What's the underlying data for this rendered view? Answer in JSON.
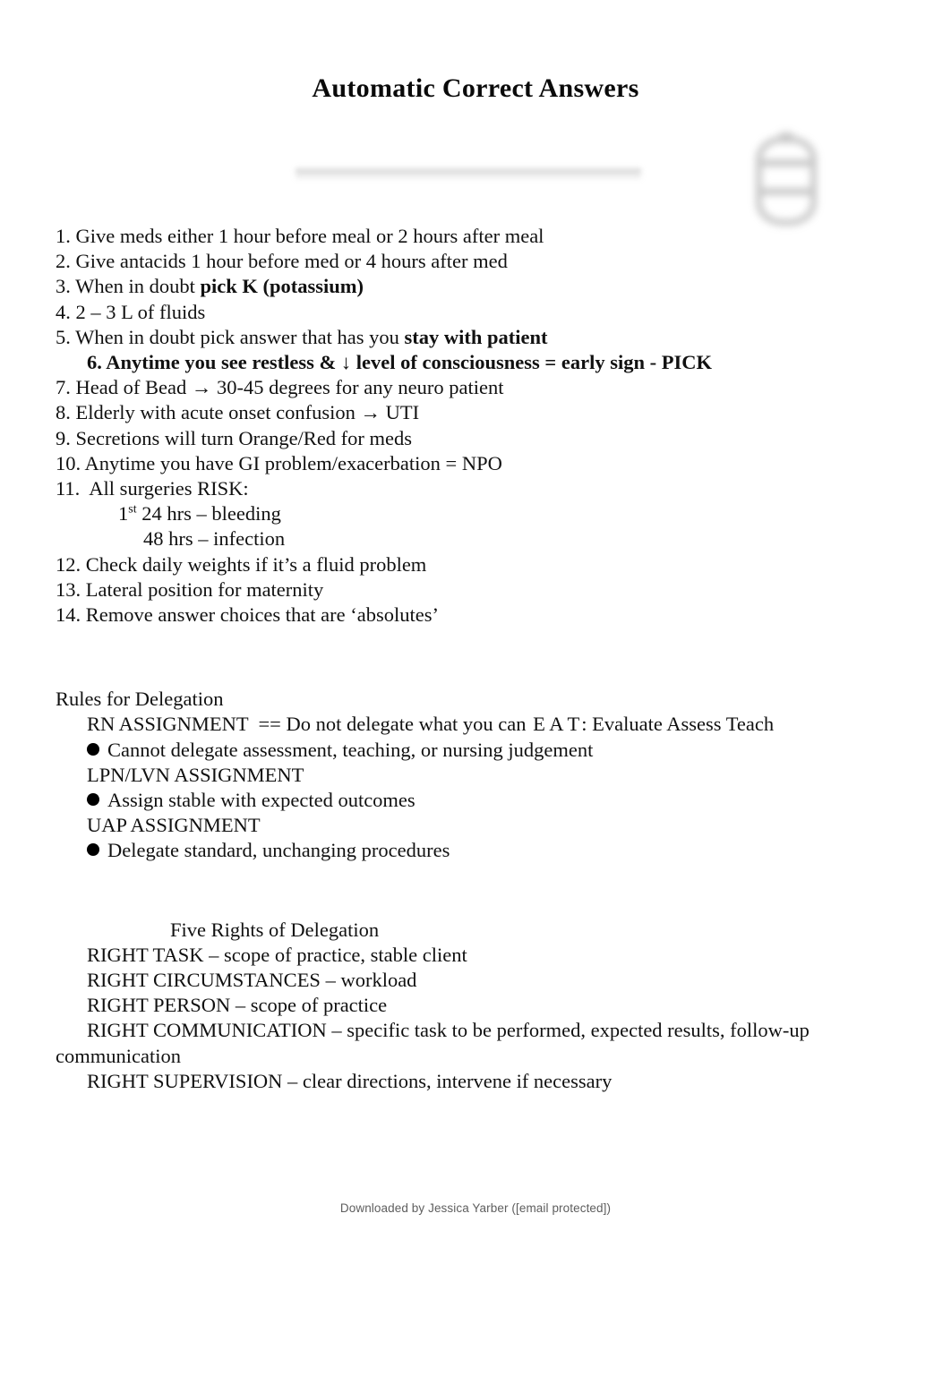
{
  "document": {
    "title": "Automatic Correct  Answers",
    "watermark_icon": "blurred-logo-watermark"
  },
  "rules_list": {
    "items": [
      {
        "num": "1.",
        "text": "Give meds either 1 hour before meal or 2 hours after meal"
      },
      {
        "num": "2.",
        "text": "Give antacids 1 hour before med or 4 hours after med"
      },
      {
        "num": "3.",
        "text": "When in doubt ",
        "bold_tail": "pick K (potassium)"
      },
      {
        "num": "4.",
        "text": "2 – 3 L of fluids"
      },
      {
        "num": "5.",
        "text": "When in doubt pick answer that has you ",
        "bold_tail": "stay with patient"
      },
      {
        "num": "6.",
        "text": "Anytime you see restless & ↓ level of consciousness = early sign - PICK"
      },
      {
        "num": "7.",
        "text": "Head of Bead → 30-45 degrees for any neuro patient"
      },
      {
        "num": "8.",
        "text": "Elderly with acute onset confusion → UTI"
      },
      {
        "num": "9.",
        "text": "Secretions will turn Orange/Red for meds"
      },
      {
        "num": "10.",
        "text": "Anytime you have GI problem/exacerbation = NPO"
      },
      {
        "num": "11.",
        "text": " All surgeries RISK:"
      }
    ],
    "surgery_risk": {
      "line1_pre": "1",
      "line1_sup": "st",
      "line1_post": " 24 hrs – bleeding",
      "line2": "48 hrs – infection"
    },
    "items_tail": [
      {
        "num": "12.",
        "text": "Check daily weights if it’s a fluid problem"
      },
      {
        "num": "13.",
        "text": "Lateral position for maternity"
      },
      {
        "num": "14.",
        "text": "Remove answer choices that are ‘absolutes’"
      }
    ]
  },
  "delegation": {
    "heading": "Rules for Delegation",
    "rn": {
      "label": "RN ASSIGNMENT  == Do not delegate what you can ",
      "highlight": "E A T",
      "highlight_color": "#1ee3f0",
      "tail": ": Evaluate Assess Teach",
      "bullet": "Cannot delegate assessment, teaching, or nursing judgement"
    },
    "lpn": {
      "label": "LPN/LVN ASSIGNMENT",
      "bullet": "Assign stable with expected outcomes"
    },
    "uap": {
      "label": "UAP ASSIGNMENT",
      "bullet": "Delegate standard, unchanging procedures"
    }
  },
  "five_rights": {
    "heading": "Five Rights of Delegation",
    "items": [
      "RIGHT TASK – scope of practice, stable client",
      "RIGHT CIRCUMSTANCES – workload",
      "RIGHT PERSON – scope of practice",
      "RIGHT COMMUNICATION – specific task to be performed, expected results, follow-up",
      "communication",
      "RIGHT SUPERVISION – clear directions, intervene if necessary"
    ]
  },
  "footer": {
    "text": "Downloaded by Jessica Yarber ([email protected])"
  }
}
